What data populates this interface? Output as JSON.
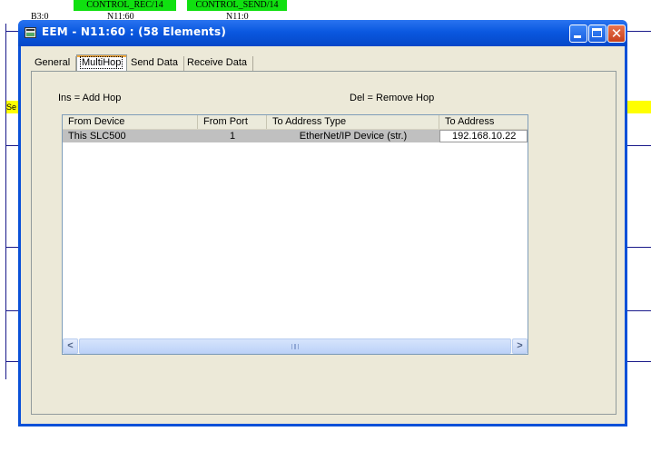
{
  "background": {
    "tags": [
      "CONTROL_REC/14",
      "CONTROL_SEND/14"
    ],
    "row_labels": [
      "B3:0",
      "N11:60",
      "N11:0"
    ],
    "side_label": "Se"
  },
  "window": {
    "title": "EEM - N11:60 : (58 Elements)",
    "buttons": {
      "minimize": "",
      "maximize": "",
      "close": "✕"
    }
  },
  "tabs": [
    {
      "label": "General",
      "active": false
    },
    {
      "label": "MultiHop",
      "active": true
    },
    {
      "label": "Send Data",
      "active": false
    },
    {
      "label": "Receive Data",
      "active": false
    }
  ],
  "hints": {
    "insert": "Ins = Add Hop",
    "delete": "Del = Remove Hop"
  },
  "table": {
    "columns": [
      "From Device",
      "From Port",
      "To Address Type",
      "To Address"
    ],
    "rows": [
      {
        "from_device": "This SLC500",
        "from_port": "1",
        "to_address_type": "EtherNet/IP Device (str.)",
        "to_address": "192.168.10.22"
      }
    ]
  },
  "scrollbar": {
    "left_arrow": "<",
    "right_arrow": ">"
  }
}
